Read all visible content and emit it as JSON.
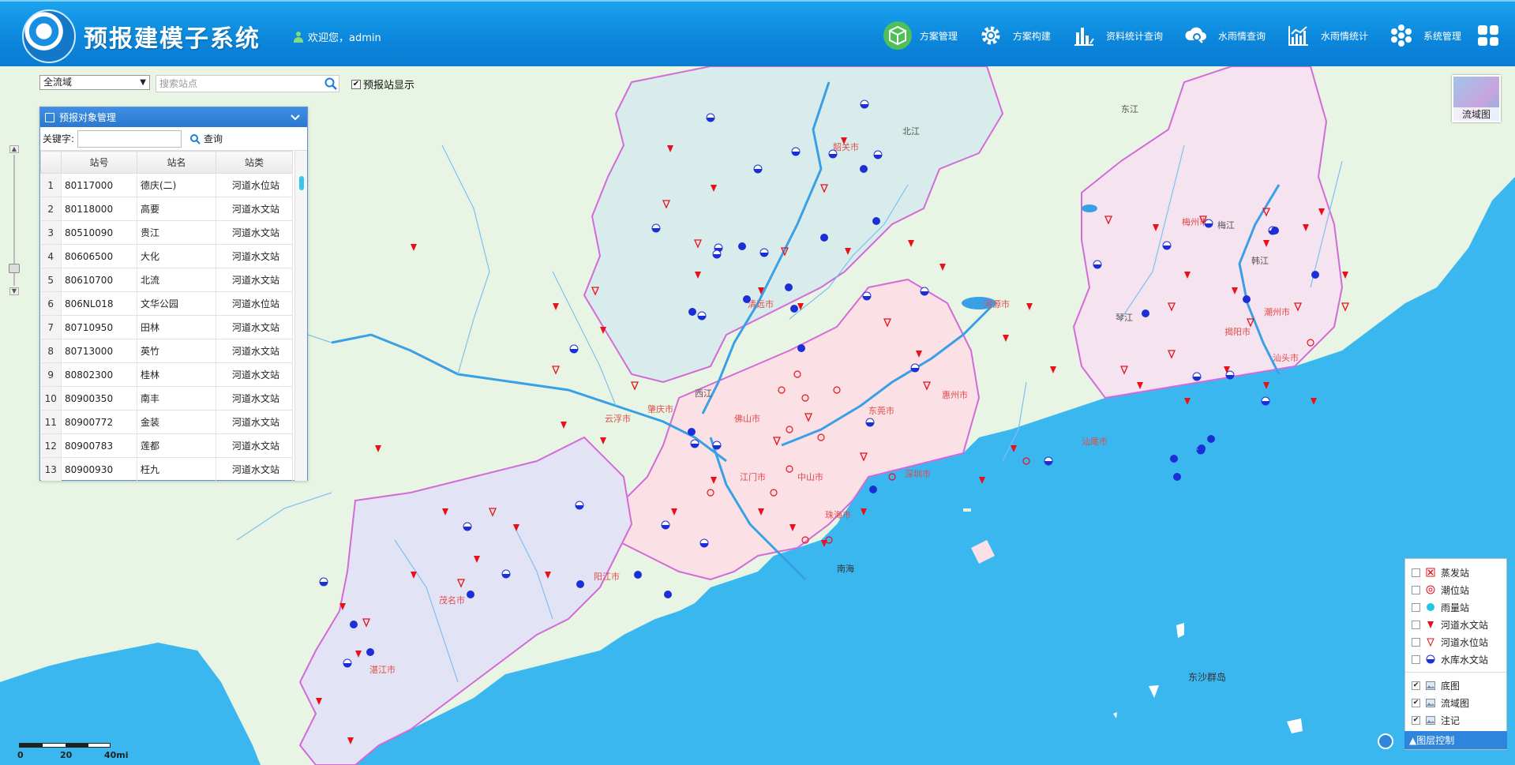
{
  "app": {
    "title": "预报建模子系统",
    "welcome": "欢迎您，admin"
  },
  "nav": [
    {
      "label": "方案管理",
      "icon": "cube-icon",
      "active": true
    },
    {
      "label": "方案构建",
      "icon": "gear-icon",
      "active": false
    },
    {
      "label": "资料统计查询",
      "icon": "chart-bar-icon",
      "active": false
    },
    {
      "label": "水雨情查询",
      "icon": "cloud-search-icon",
      "active": false
    },
    {
      "label": "水雨情统计",
      "icon": "line-chart-icon",
      "active": false
    },
    {
      "label": "系统管理",
      "icon": "flower-icon",
      "active": false
    }
  ],
  "toolbar": {
    "basin_value": "全流域",
    "search_placeholder": "搜索站点",
    "forecast_display_label": "预报站显示",
    "forecast_display_checked": true
  },
  "panel": {
    "title": "预报对象管理",
    "keyword_label": "关键字:",
    "query_label": "查询",
    "columns": [
      "站号",
      "站名",
      "站类"
    ],
    "rows": [
      {
        "idx": "1",
        "code": "80117000",
        "name": "德庆(二)",
        "type": "河道水位站"
      },
      {
        "idx": "2",
        "code": "80118000",
        "name": "高要",
        "type": "河道水文站"
      },
      {
        "idx": "3",
        "code": "80510090",
        "name": "贵江",
        "type": "河道水文站"
      },
      {
        "idx": "4",
        "code": "80606500",
        "name": "大化",
        "type": "河道水文站"
      },
      {
        "idx": "5",
        "code": "80610700",
        "name": "北流",
        "type": "河道水文站"
      },
      {
        "idx": "6",
        "code": "806NL018",
        "name": "文华公园",
        "type": "河道水位站"
      },
      {
        "idx": "7",
        "code": "80710950",
        "name": "田林",
        "type": "河道水文站"
      },
      {
        "idx": "8",
        "code": "80713000",
        "name": "英竹",
        "type": "河道水文站"
      },
      {
        "idx": "9",
        "code": "80802300",
        "name": "桂林",
        "type": "河道水文站"
      },
      {
        "idx": "10",
        "code": "80900350",
        "name": "南丰",
        "type": "河道水文站"
      },
      {
        "idx": "11",
        "code": "80900772",
        "name": "金装",
        "type": "河道水文站"
      },
      {
        "idx": "12",
        "code": "80900783",
        "name": "莲都",
        "type": "河道水文站"
      },
      {
        "idx": "13",
        "code": "80900930",
        "name": "枉九",
        "type": "河道水文站"
      }
    ]
  },
  "basin_map_label": "流域图",
  "legend": {
    "stations": [
      {
        "label": "蒸发站",
        "icon": "evaporation-station-icon"
      },
      {
        "label": "潮位站",
        "icon": "tide-station-icon"
      },
      {
        "label": "雨量站",
        "icon": "rain-station-icon"
      },
      {
        "label": "河道水文站",
        "icon": "river-hydro-station-icon"
      },
      {
        "label": "河道水位站",
        "icon": "river-level-station-icon"
      },
      {
        "label": "水库水文站",
        "icon": "reservoir-station-icon"
      }
    ],
    "layers": [
      {
        "label": "底图",
        "checked": true
      },
      {
        "label": "流域图",
        "checked": true
      },
      {
        "label": "注记",
        "checked": true
      }
    ],
    "footer": "▲图层控制"
  },
  "scale": {
    "t0": "0",
    "t1": "20",
    "t2": "40mi"
  },
  "map_labels": [
    {
      "text": "北江"
    },
    {
      "text": "韶关市"
    },
    {
      "text": "东江"
    },
    {
      "text": "梅州市"
    },
    {
      "text": "梅江"
    },
    {
      "text": "韩江"
    },
    {
      "text": "清远市"
    },
    {
      "text": "河源市"
    },
    {
      "text": "揭阳市"
    },
    {
      "text": "潮州市"
    },
    {
      "text": "汕头市"
    },
    {
      "text": "琴江"
    },
    {
      "text": "西江"
    },
    {
      "text": "肇庆市"
    },
    {
      "text": "云浮市"
    },
    {
      "text": "佛山市"
    },
    {
      "text": "东莞市"
    },
    {
      "text": "惠州市"
    },
    {
      "text": "汕尾市"
    },
    {
      "text": "江门市"
    },
    {
      "text": "中山市"
    },
    {
      "text": "深圳市"
    },
    {
      "text": "珠海市"
    },
    {
      "text": "阳江市"
    },
    {
      "text": "茂名市"
    },
    {
      "text": "湛江市"
    },
    {
      "text": "东沙群岛"
    },
    {
      "text": "南海"
    }
  ],
  "colors": {
    "header": "#0b86db",
    "sea": "#3ab7ef",
    "land": "#e9f5e4",
    "basin_north": "#d9ecec",
    "basin_east": "#f6e3f0",
    "basin_delta": "#fbe1e6",
    "basin_west": "#e3e3f6",
    "boundary": "#d36ad8",
    "river": "#3aa0e6",
    "station_red": "#e8111b",
    "station_blue": "#1c2fd6"
  }
}
